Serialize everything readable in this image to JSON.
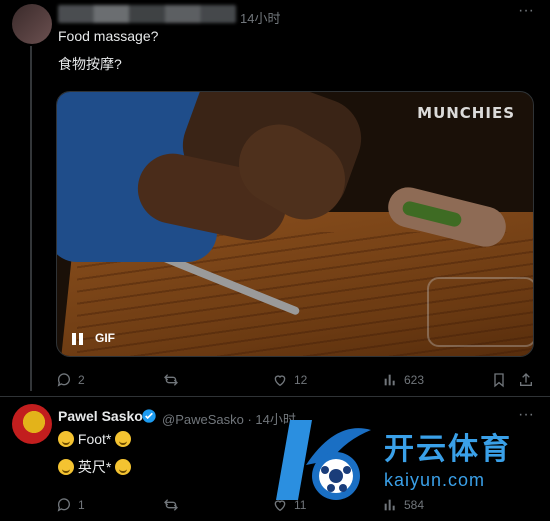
{
  "tweet": {
    "time": "14小时",
    "text_en": "Food massage?",
    "text_zh": "食物按摩?",
    "media": {
      "watermark": "MUNCHIES",
      "gif_label": "GIF"
    },
    "stats": {
      "replies": "2",
      "retweets": "",
      "likes": "12",
      "views": "623"
    }
  },
  "reply": {
    "name": "Pawel Sasko",
    "handle_time": "@PaweSasko · 14小时",
    "line1": "Foot*",
    "line2": "英尺*",
    "stats": {
      "replies": "1",
      "retweets": "",
      "likes": "11",
      "views": "584"
    }
  },
  "watermark": {
    "brand": "开云体育",
    "url": "kaiyun.com"
  },
  "colors": {
    "bg": "#000000",
    "text": "#e7e9ea",
    "muted": "#71767b",
    "accent": "#1d9bf0",
    "watermark": "#3aa0e8"
  }
}
